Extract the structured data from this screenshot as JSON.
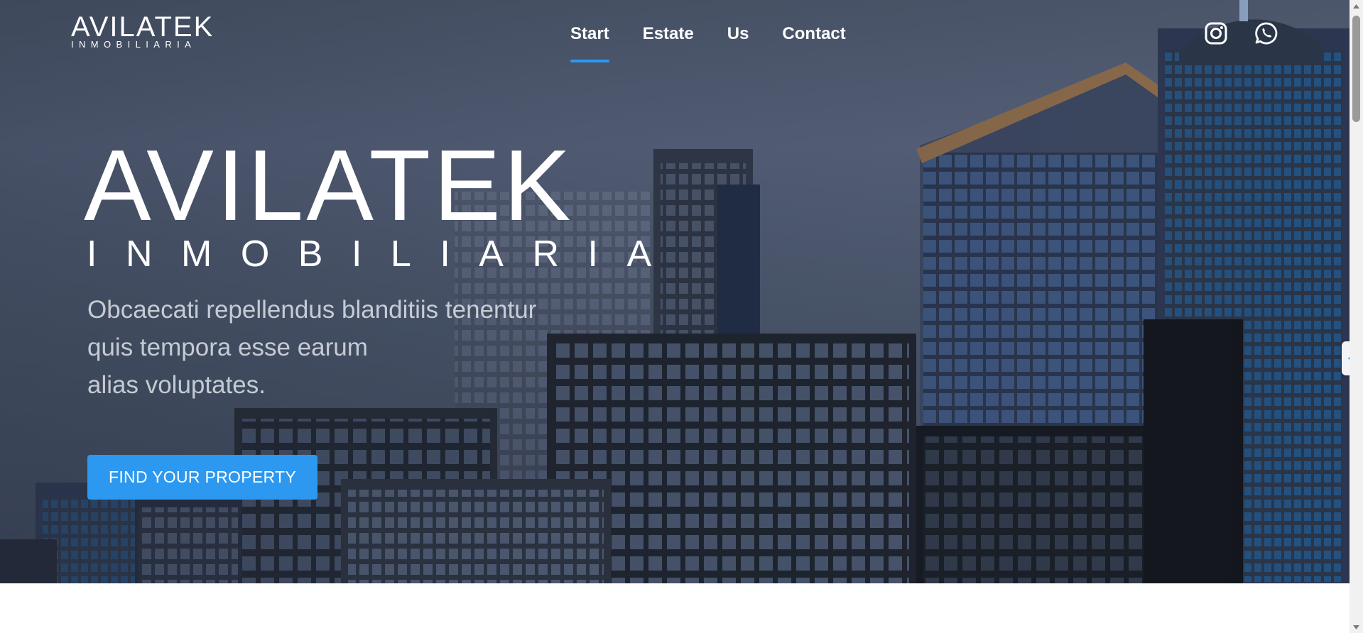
{
  "header": {
    "logo": {
      "main": "AVILATEK",
      "sub": "INMOBILIARIA"
    },
    "nav": [
      {
        "label": "Start",
        "active": true
      },
      {
        "label": "Estate",
        "active": false
      },
      {
        "label": "Us",
        "active": false
      },
      {
        "label": "Contact",
        "active": false
      }
    ],
    "social": [
      "instagram-icon",
      "whatsapp-icon"
    ]
  },
  "hero": {
    "title": "AVILATEK",
    "subtitle": "INMOBILIARIA",
    "description": [
      "Obcaecati repellendus blanditiis tenentur",
      "quis tempora esse earum",
      "alias voluptates."
    ],
    "cta_label": "FIND YOUR PROPERTY"
  },
  "colors": {
    "accent": "#2c98f0",
    "hero_overlay": "#4b566a",
    "text": "#ffffff"
  },
  "side_tab": {
    "icon": "chevron-left-icon"
  }
}
